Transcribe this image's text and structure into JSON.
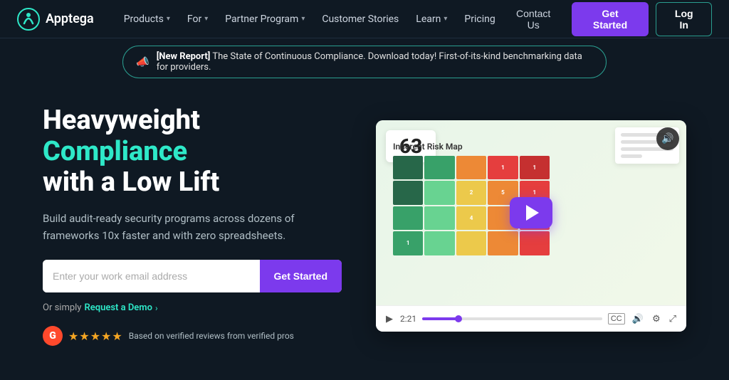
{
  "brand": {
    "name": "Apptega",
    "logo_alt": "Apptega logo"
  },
  "nav": {
    "links": [
      {
        "label": "Products",
        "has_dropdown": true
      },
      {
        "label": "For",
        "has_dropdown": true
      },
      {
        "label": "Partner Program",
        "has_dropdown": true
      },
      {
        "label": "Customer Stories",
        "has_dropdown": false
      },
      {
        "label": "Learn",
        "has_dropdown": true
      },
      {
        "label": "Pricing",
        "has_dropdown": false
      }
    ],
    "contact_label": "Contact Us",
    "get_started_label": "Get Started",
    "login_label": "Log In"
  },
  "announcement": {
    "icon": "📣",
    "text": "[New Report] The State of Continuous Compliance. Download today! First-of-its-kind benchmarking data for providers."
  },
  "hero": {
    "title_line1": "Heavyweight",
    "title_accent": "Compliance",
    "title_line3": "with a Low Lift",
    "description": "Build audit-ready security programs across dozens of frameworks 10x faster and with zero spreadsheets.",
    "email_placeholder": "Enter your work email address",
    "cta_label": "Get Started",
    "request_demo_prefix": "Or simply",
    "request_demo_link": "Request a Demo",
    "request_demo_arrow": "›",
    "reviews": {
      "stars": "★★★★★",
      "text": "Based on verified reviews from verified pros"
    }
  },
  "video": {
    "score": "63",
    "risk_map_title": "Inherent Risk Map",
    "time_current": "2:21",
    "time_total": "",
    "caption_icon": "CC",
    "volume_icon": "🔊",
    "settings_icon": "⚙",
    "fullscreen_icon": "⤢"
  },
  "risk_colors": {
    "red": "#e53e3e",
    "orange": "#ed8936",
    "yellow": "#ecc94b",
    "light_green": "#68d391",
    "green": "#38a169",
    "dark_green": "#276749"
  }
}
